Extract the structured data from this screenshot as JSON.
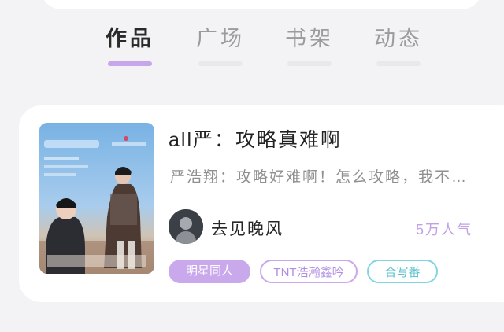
{
  "tabs": [
    {
      "label": "作品",
      "active": true
    },
    {
      "label": "广场",
      "active": false
    },
    {
      "label": "书架",
      "active": false
    },
    {
      "label": "动态",
      "active": false
    }
  ],
  "book": {
    "title": "all严：攻略真难啊",
    "description": "严浩翔：攻略好难啊！怎么攻略，我不…",
    "author": "去见晚风",
    "popularity": "5万人气",
    "tags": [
      "明星同人",
      "TNT浩瀚鑫吟",
      "合写番"
    ]
  },
  "colors": {
    "accent_purple": "#c9a8ec",
    "accent_cyan": "#7fd6e0",
    "background": "#f3f2f4"
  },
  "icons": {
    "cover": "book-cover-image",
    "avatar": "author-avatar-image"
  }
}
